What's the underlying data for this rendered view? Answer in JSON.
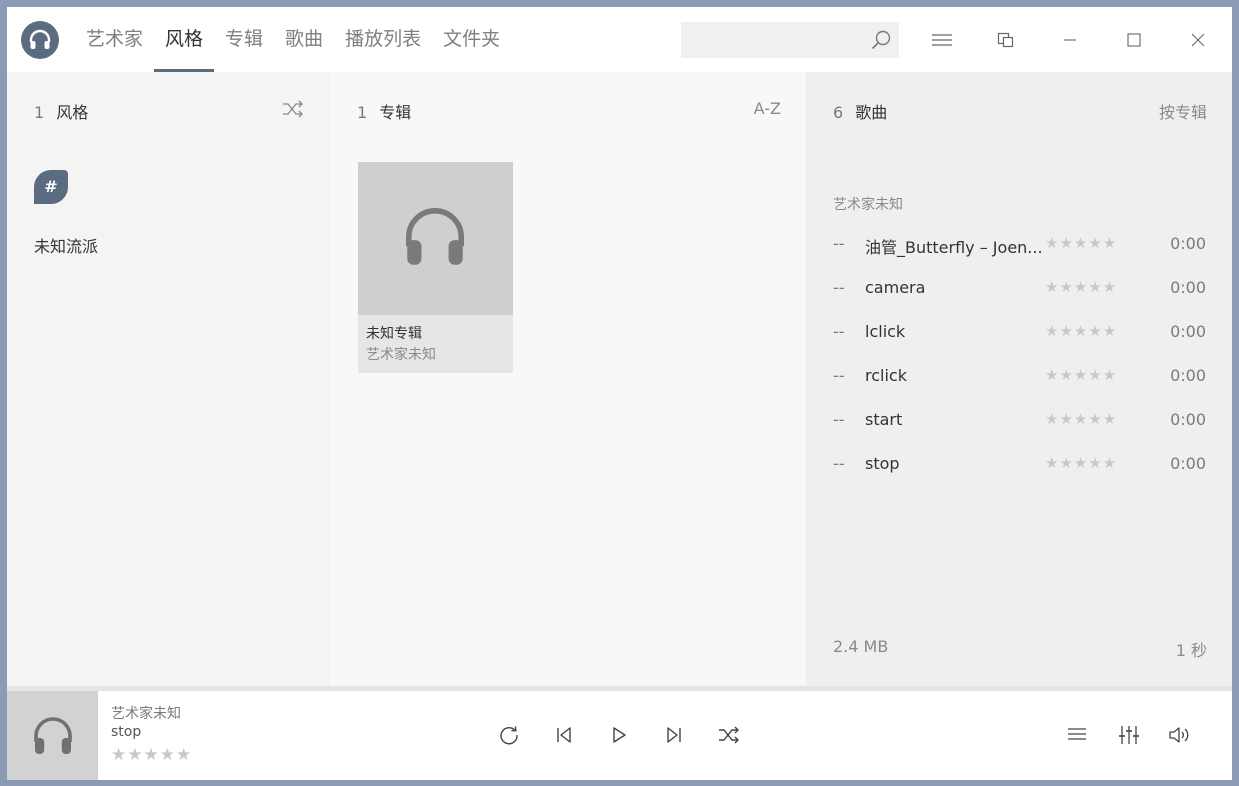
{
  "tabs": [
    {
      "label": "艺术家"
    },
    {
      "label": "风格"
    },
    {
      "label": "专辑"
    },
    {
      "label": "歌曲"
    },
    {
      "label": "播放列表"
    },
    {
      "label": "文件夹"
    }
  ],
  "active_tab": "风格",
  "search": {
    "value": "",
    "placeholder": ""
  },
  "genres_panel": {
    "count": "1",
    "title": "风格",
    "items": [
      {
        "badge": "#",
        "name": "未知流派"
      }
    ]
  },
  "albums_panel": {
    "count": "1",
    "title": "专辑",
    "sort_label": "A-Z",
    "items": [
      {
        "title": "未知专辑",
        "artist": "艺术家未知"
      }
    ]
  },
  "songs_panel": {
    "count": "6",
    "title": "歌曲",
    "sort_label": "按专辑",
    "group_label": "艺术家未知",
    "songs": [
      {
        "track": "--",
        "title": "油管_Butterfly – Joen...",
        "rating": "★★★★★",
        "duration": "0:00"
      },
      {
        "track": "--",
        "title": "camera",
        "rating": "★★★★★",
        "duration": "0:00"
      },
      {
        "track": "--",
        "title": "lclick",
        "rating": "★★★★★",
        "duration": "0:00"
      },
      {
        "track": "--",
        "title": "rclick",
        "rating": "★★★★★",
        "duration": "0:00"
      },
      {
        "track": "--",
        "title": "start",
        "rating": "★★★★★",
        "duration": "0:00"
      },
      {
        "track": "--",
        "title": "stop",
        "rating": "★★★★★",
        "duration": "0:00"
      }
    ],
    "total_size": "2.4 MB",
    "total_time": "1 秒"
  },
  "now_playing": {
    "artist": "艺术家未知",
    "title": "stop",
    "rating": "★★★★★"
  },
  "colors": {
    "accent": "#5b6b80",
    "frame": "#8a9bb3"
  },
  "icons": {
    "logo": "headphones-icon",
    "search": "search-icon",
    "menu": "hamburger-menu-icon",
    "restore_view": "compact-view-icon",
    "minimize": "minimize-icon",
    "maximize": "maximize-icon",
    "close": "close-icon",
    "shuffle": "shuffle-icon",
    "repeat": "repeat-icon",
    "previous": "previous-icon",
    "play": "play-icon",
    "next": "next-icon",
    "queue": "queue-icon",
    "equalizer": "equalizer-icon",
    "volume": "volume-icon"
  }
}
